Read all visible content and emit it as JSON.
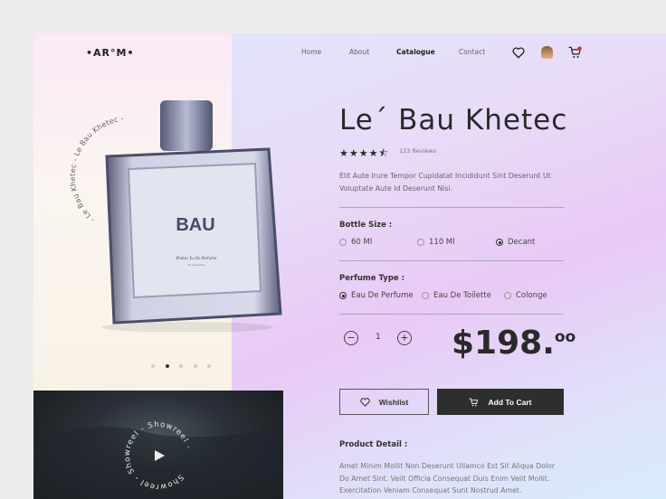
{
  "logo": "•AR°M•",
  "nav": [
    {
      "label": "Home"
    },
    {
      "label": "About"
    },
    {
      "label": "Catalogue",
      "active": true
    },
    {
      "label": "Contact"
    }
  ],
  "header_icons": [
    "heart-icon",
    "avatar",
    "cart-icon"
  ],
  "hero": {
    "circular_text": "- Le Bau Khetec - Le Bau Khetec -",
    "bottle_label": "BAU",
    "bottle_sub": "Khetec Eu De Parfume",
    "bottle_sub2": "for everyday",
    "slide_count": 5,
    "active_slide": 2
  },
  "video": {
    "circular_text": "Showreel - Showreel - Showreel - ",
    "icon": "play-icon"
  },
  "product": {
    "title": "Le´ Bau Khetec",
    "rating": 4.5,
    "stars": "★★★★⯪",
    "reviews": "123 Reviews",
    "description": "Elit Aute Irure Tempor Cupidatat Incididunt Sint Deserunt Ut Voluptate Aute Id Deserunt Nisi.",
    "bottle_size_label": "Bottle Size :",
    "bottle_sizes": [
      {
        "label": "60 Ml",
        "selected": false
      },
      {
        "label": "110 Ml",
        "selected": false
      },
      {
        "label": "Decant",
        "selected": true
      }
    ],
    "perfume_type_label": "Perfume Type :",
    "perfume_types": [
      {
        "label": "Eau De Perfume",
        "selected": true
      },
      {
        "label": "Eau De Toilette",
        "selected": false
      },
      {
        "label": "Colonge",
        "selected": false
      }
    ],
    "quantity": "1",
    "minus": "−",
    "plus": "+",
    "price_main": "$198.",
    "price_cents": "oo",
    "wishlist_label": "Wishlist",
    "add_to_cart_label": "Add To Cart",
    "detail_label": "Product Detail :",
    "detail_text": "Amet Minim Mollit Non Deserunt Ullamco Est Sit Aliqua Dolor Do Amet Sint. Velit Officia Consequat Duis Enim Velit Mollit. Exercitation Veniam Consequat Sunt Nostrud Amet."
  },
  "colors": {
    "dark": "#2e2e2e",
    "cart_badge": "#e0223a"
  }
}
